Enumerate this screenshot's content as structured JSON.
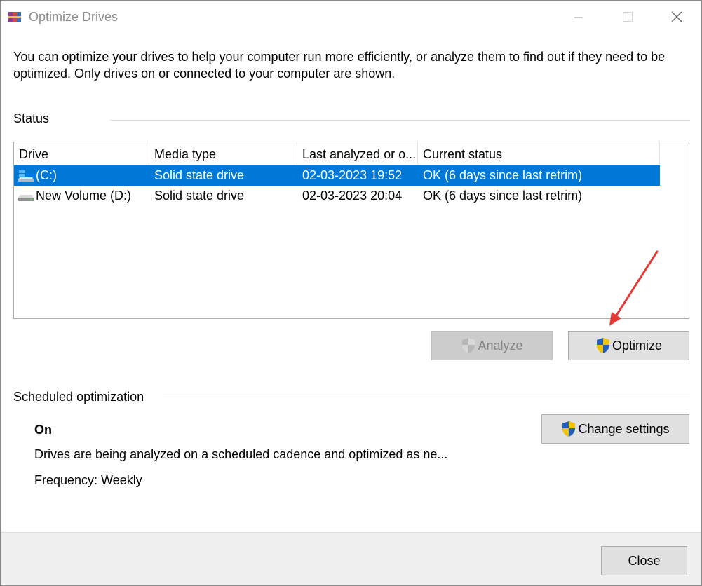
{
  "window": {
    "title": "Optimize Drives",
    "controls": {
      "minimize": "minimize-icon",
      "maximize": "maximize-icon",
      "close": "close-icon"
    }
  },
  "intro_text": "You can optimize your drives to help your computer run more efficiently, or analyze them to find out if they need to be optimized. Only drives on or connected to your computer are shown.",
  "status": {
    "label": "Status",
    "columns": [
      "Drive",
      "Media type",
      "Last analyzed or o...",
      "Current status"
    ],
    "rows": [
      {
        "drive": "(C:)",
        "media_type": "Solid state drive",
        "last_analyzed": "02-03-2023 19:52",
        "current_status": "OK (6 days since last retrim)",
        "selected": true,
        "icon": "windows-drive-icon"
      },
      {
        "drive": "New Volume (D:)",
        "media_type": "Solid state drive",
        "last_analyzed": "02-03-2023 20:04",
        "current_status": "OK (6 days since last retrim)",
        "selected": false,
        "icon": "drive-icon"
      }
    ]
  },
  "buttons": {
    "analyze": "Analyze",
    "optimize": "Optimize",
    "change_settings": "Change settings",
    "close": "Close"
  },
  "scheduled": {
    "label": "Scheduled optimization",
    "state": "On",
    "description": "Drives are being analyzed on a scheduled cadence and optimized as ne...",
    "frequency": "Frequency: Weekly"
  },
  "colors": {
    "selection": "#0078d7",
    "annotation_arrow": "#e53935"
  }
}
